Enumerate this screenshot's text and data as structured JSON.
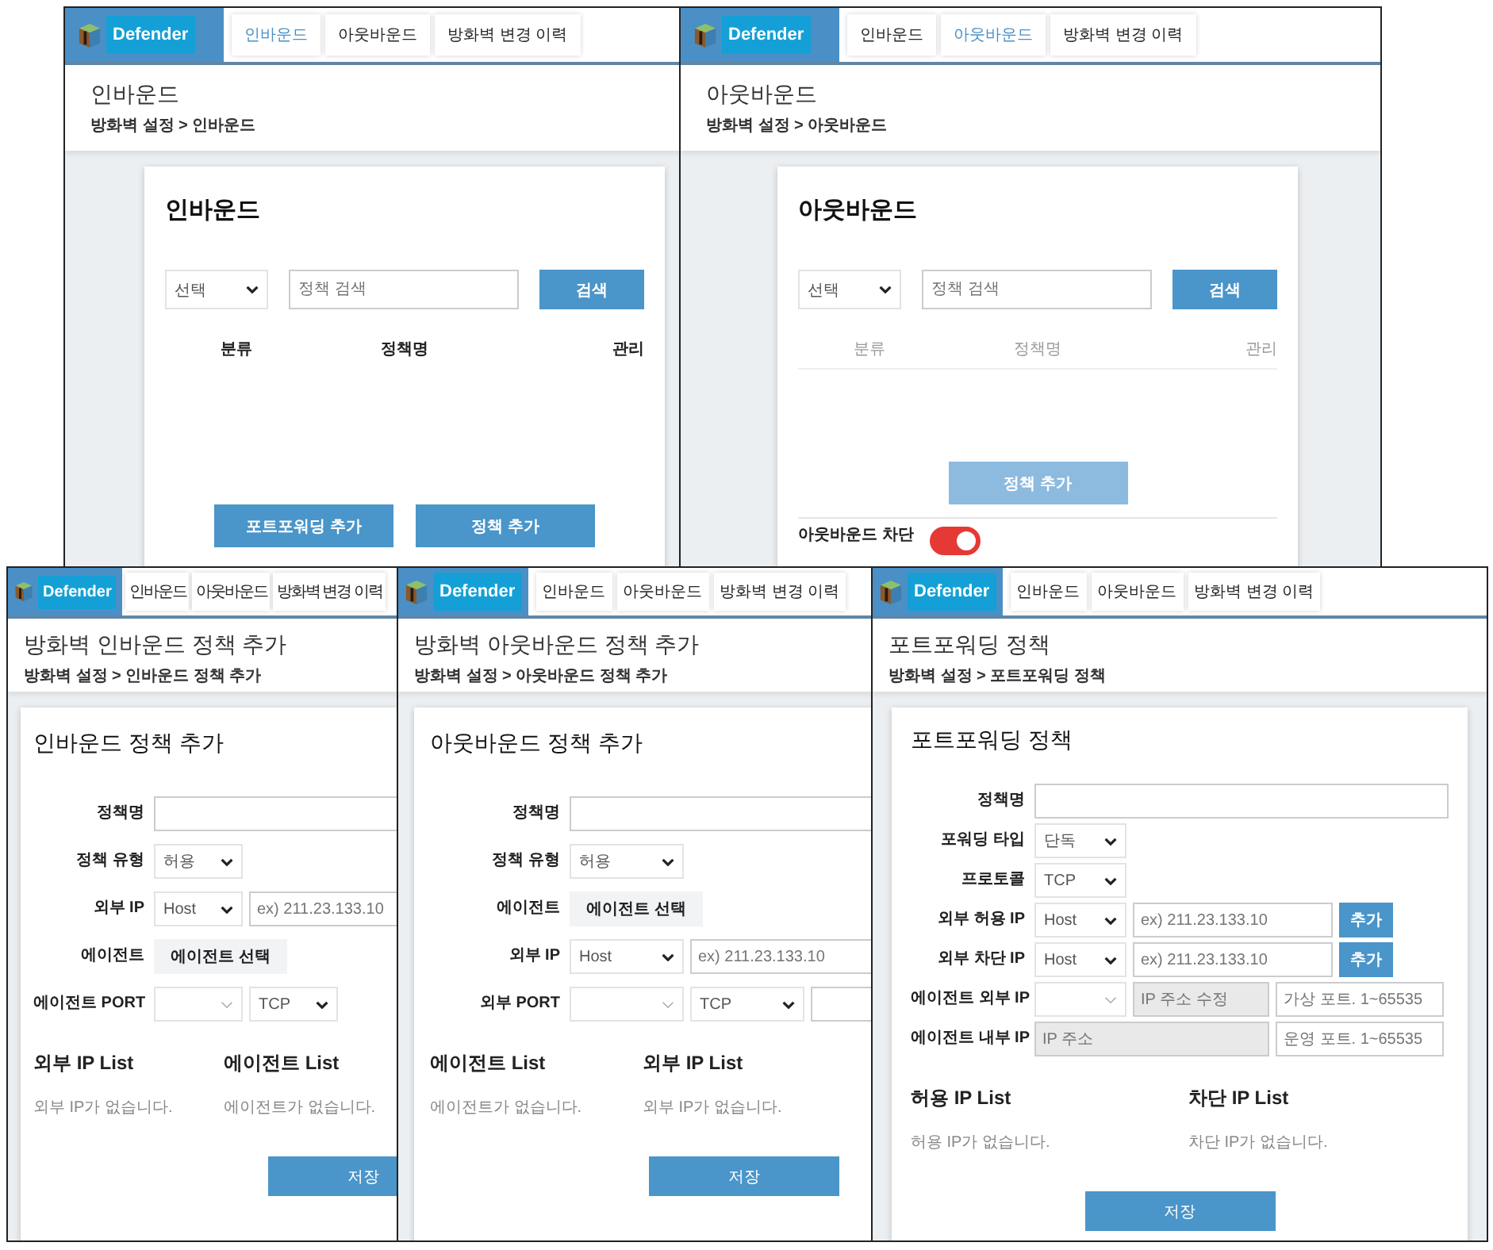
{
  "windows": [
    {
      "kind": "list",
      "app": "Defender",
      "nav": [
        {
          "label": "인바운드",
          "selected": true
        },
        {
          "label": "아웃바운드",
          "selected": false
        },
        {
          "label": "방화벽 변경 이력",
          "selected": false
        }
      ],
      "page_title": "인바운드",
      "breadcrumb": "방화벽 설정 > 인바운드",
      "card_title": "인바운드",
      "filter": {
        "value": "선택"
      },
      "search": {
        "placeholder": "정책 검색"
      },
      "search_button": "검색",
      "columns": [
        "분류",
        "정책명",
        "관리"
      ],
      "muted_columns": false,
      "buttons": [
        {
          "label": "포트포워딩 추가",
          "disabled": false
        },
        {
          "label": "정책 추가",
          "disabled": false
        }
      ]
    },
    {
      "kind": "list",
      "app": "Defender",
      "nav": [
        {
          "label": "인바운드",
          "selected": false
        },
        {
          "label": "아웃바운드",
          "selected": true
        },
        {
          "label": "방화벽 변경 이력",
          "selected": false
        }
      ],
      "page_title": "아웃바운드",
      "breadcrumb": "방화벽 설정 > 아웃바운드",
      "card_title": "아웃바운드",
      "filter": {
        "value": "선택"
      },
      "search": {
        "placeholder": "정책 검색"
      },
      "search_button": "검색",
      "columns": [
        "분류",
        "정책명",
        "관리"
      ],
      "muted_columns": true,
      "buttons": [
        {
          "label": "정책 추가",
          "disabled": true
        }
      ],
      "toggle": {
        "label": "아웃바운드 차단",
        "on": true
      }
    },
    {
      "kind": "form",
      "app": "Defender",
      "nav": [
        {
          "label": "인바운드",
          "selected": false
        },
        {
          "label": "아웃바운드",
          "selected": false
        },
        {
          "label": "방화벽 변경 이력",
          "selected": false
        }
      ],
      "page_title": "방화벽 인바운드 정책 추가",
      "breadcrumb": "방화벽 설정 > 인바운드 정책 추가",
      "card_title": "인바운드 정책 추가",
      "fields": [
        {
          "label": "정책명",
          "controls": [
            {
              "kind": "input"
            }
          ]
        },
        {
          "label": "정책 유형",
          "controls": [
            {
              "kind": "select",
              "value": "허용"
            }
          ]
        },
        {
          "label": "외부 IP",
          "controls": [
            {
              "kind": "select",
              "value": "Host"
            },
            {
              "kind": "input",
              "placeholder": "ex) 211.23.133.10"
            }
          ]
        },
        {
          "label": "에이전트",
          "controls": [
            {
              "kind": "picker",
              "label": "에이전트 선택"
            }
          ]
        },
        {
          "label": "에이전트 PORT",
          "controls": [
            {
              "kind": "select"
            },
            {
              "kind": "select",
              "value": "TCP"
            }
          ]
        }
      ],
      "lists": [
        {
          "title": "외부 IP List",
          "empty": "외부 IP가 없습니다."
        },
        {
          "title": "에이전트 List",
          "empty": "에이전트가 없습니다."
        }
      ],
      "save_button": "저장"
    },
    {
      "kind": "form",
      "app": "Defender",
      "nav": [
        {
          "label": "인바운드",
          "selected": false
        },
        {
          "label": "아웃바운드",
          "selected": false
        },
        {
          "label": "방화벽 변경 이력",
          "selected": false
        }
      ],
      "page_title": "방화벽 아웃바운드 정책 추가",
      "breadcrumb": "방화벽 설정 > 아웃바운드 정책 추가",
      "card_title": "아웃바운드 정책 추가",
      "fields": [
        {
          "label": "정책명",
          "controls": [
            {
              "kind": "input"
            }
          ]
        },
        {
          "label": "정책 유형",
          "controls": [
            {
              "kind": "select",
              "value": "허용"
            }
          ]
        },
        {
          "label": "에이전트",
          "controls": [
            {
              "kind": "picker",
              "label": "에이전트 선택"
            }
          ]
        },
        {
          "label": "외부 IP",
          "controls": [
            {
              "kind": "select",
              "value": "Host"
            },
            {
              "kind": "input",
              "placeholder": "ex) 211.23.133.10"
            }
          ]
        },
        {
          "label": "외부 PORT",
          "controls": [
            {
              "kind": "select"
            },
            {
              "kind": "select",
              "value": "TCP"
            },
            {
              "kind": "input"
            }
          ]
        }
      ],
      "lists": [
        {
          "title": "에이전트 List",
          "empty": "에이전트가 없습니다."
        },
        {
          "title": "외부 IP List",
          "empty": "외부 IP가 없습니다."
        }
      ],
      "save_button": "저장"
    },
    {
      "kind": "form",
      "app": "Defender",
      "nav": [
        {
          "label": "인바운드",
          "selected": false
        },
        {
          "label": "아웃바운드",
          "selected": false
        },
        {
          "label": "방화벽 변경 이력",
          "selected": false
        }
      ],
      "page_title": "포트포워딩 정책",
      "breadcrumb": "방화벽 설정 > 포트포워딩 정책",
      "card_title": "포트포워딩 정책",
      "fields": [
        {
          "label": "정책명",
          "controls": [
            {
              "kind": "input"
            }
          ]
        },
        {
          "label": "포워딩 타입",
          "controls": [
            {
              "kind": "select",
              "value": "단독"
            }
          ]
        },
        {
          "label": "프로토콜",
          "controls": [
            {
              "kind": "select",
              "value": "TCP"
            }
          ]
        },
        {
          "label": "외부 허용 IP",
          "controls": [
            {
              "kind": "select",
              "value": "Host"
            },
            {
              "kind": "input",
              "placeholder": "ex) 211.23.133.10"
            },
            {
              "kind": "add",
              "label": "추가"
            }
          ]
        },
        {
          "label": "외부 차단 IP",
          "controls": [
            {
              "kind": "select",
              "value": "Host"
            },
            {
              "kind": "input",
              "placeholder": "ex) 211.23.133.10"
            },
            {
              "kind": "add",
              "label": "추가"
            }
          ]
        },
        {
          "label": "에이전트 외부 IP",
          "controls": [
            {
              "kind": "select"
            },
            {
              "kind": "readonly",
              "placeholder": "IP 주소 수정"
            },
            {
              "kind": "input",
              "placeholder": "가상 포트. 1~65535"
            }
          ]
        },
        {
          "label": "에이전트 내부 IP",
          "controls": [
            {
              "kind": "readonly",
              "placeholder": "IP 주소"
            },
            {
              "kind": "input",
              "placeholder": "운영 포트. 1~65535"
            }
          ]
        }
      ],
      "lists": [
        {
          "title": "허용 IP List",
          "empty": "허용 IP가 없습니다."
        },
        {
          "title": "차단 IP List",
          "empty": "차단 IP가 없습니다."
        }
      ],
      "save_button": "저장"
    }
  ]
}
